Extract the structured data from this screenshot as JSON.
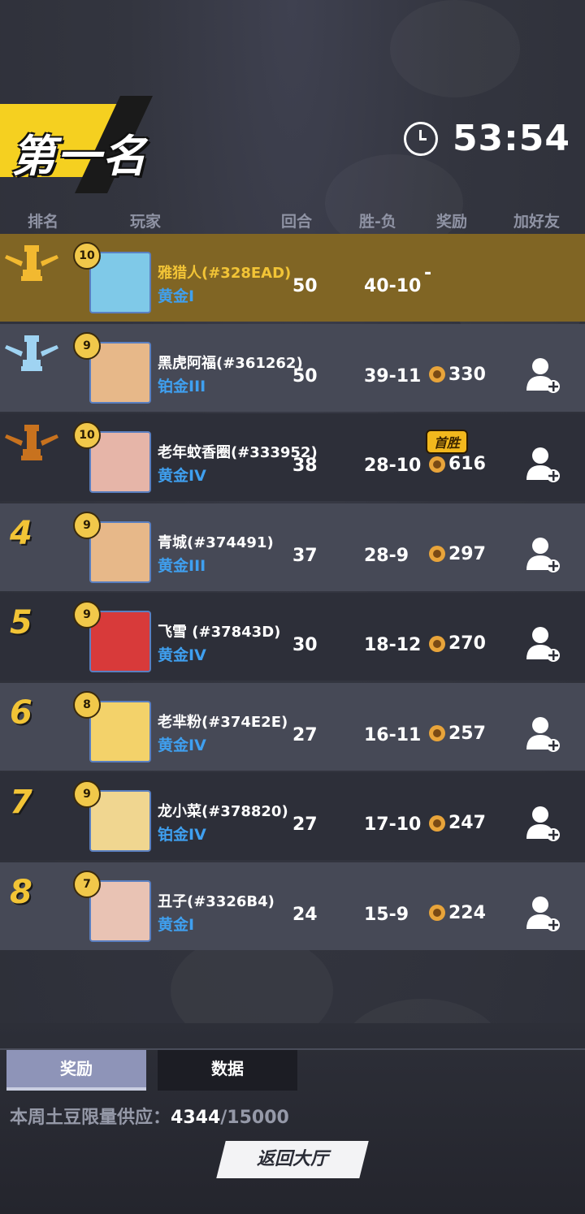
{
  "banner": {
    "title": "第一名"
  },
  "timer": {
    "time": "53:54",
    "icon": "clock-icon"
  },
  "headers": {
    "rank": "排名",
    "player": "玩家",
    "rounds": "回合",
    "winloss": "胜-负",
    "reward": "奖励",
    "add_friend": "加好友"
  },
  "players": [
    {
      "rank": "1",
      "rank_icon": "gold-rook-trophy-icon",
      "level": "10",
      "name": "雅猎人(#328EAD)",
      "tier": "黄金I",
      "rounds": "50",
      "winloss": "40-10",
      "reward": "-",
      "add_friend": false
    },
    {
      "rank": "2",
      "rank_icon": "silver-rook-trophy-icon",
      "level": "9",
      "name": "黑虎阿福(#361262)",
      "tier": "铂金III",
      "rounds": "50",
      "winloss": "39-11",
      "reward": "330",
      "add_friend": true
    },
    {
      "rank": "3",
      "rank_icon": "bronze-rook-trophy-icon",
      "level": "10",
      "name": "老年蚊香圈(#333952)",
      "tier": "黄金IV",
      "rounds": "38",
      "winloss": "28-10",
      "reward": "616",
      "badge": "首胜",
      "add_friend": true
    },
    {
      "rank": "4",
      "level": "9",
      "name": "青城(#374491)",
      "tier": "黄金III",
      "rounds": "37",
      "winloss": "28-9",
      "reward": "297",
      "add_friend": true
    },
    {
      "rank": "5",
      "level": "9",
      "name": "飞雪    (#37843D)",
      "tier": "黄金IV",
      "rounds": "30",
      "winloss": "18-12",
      "reward": "270",
      "add_friend": true
    },
    {
      "rank": "6",
      "level": "8",
      "name": "老芈粉(#374E2E)",
      "tier": "黄金IV",
      "rounds": "27",
      "winloss": "16-11",
      "reward": "257",
      "add_friend": true
    },
    {
      "rank": "7",
      "level": "9",
      "name": "龙小菜(#378820)",
      "tier": "铂金IV",
      "rounds": "27",
      "winloss": "17-10",
      "reward": "247",
      "add_friend": true
    },
    {
      "rank": "8",
      "level": "7",
      "name": "丑子(#3326B4)",
      "tier": "黄金I",
      "rounds": "24",
      "winloss": "15-9",
      "reward": "224",
      "add_friend": true
    }
  ],
  "tabs": {
    "reward": "奖励",
    "data": "数据"
  },
  "supply": {
    "label": "本周土豆限量供应：",
    "current": "4344",
    "total": "/15000"
  },
  "back_button": "返回大厅",
  "colors": {
    "gold_row": "#806524",
    "tier_blue": "#3fa0f0",
    "rank_gold": "#f2c436",
    "banner_yellow": "#f5d020"
  }
}
